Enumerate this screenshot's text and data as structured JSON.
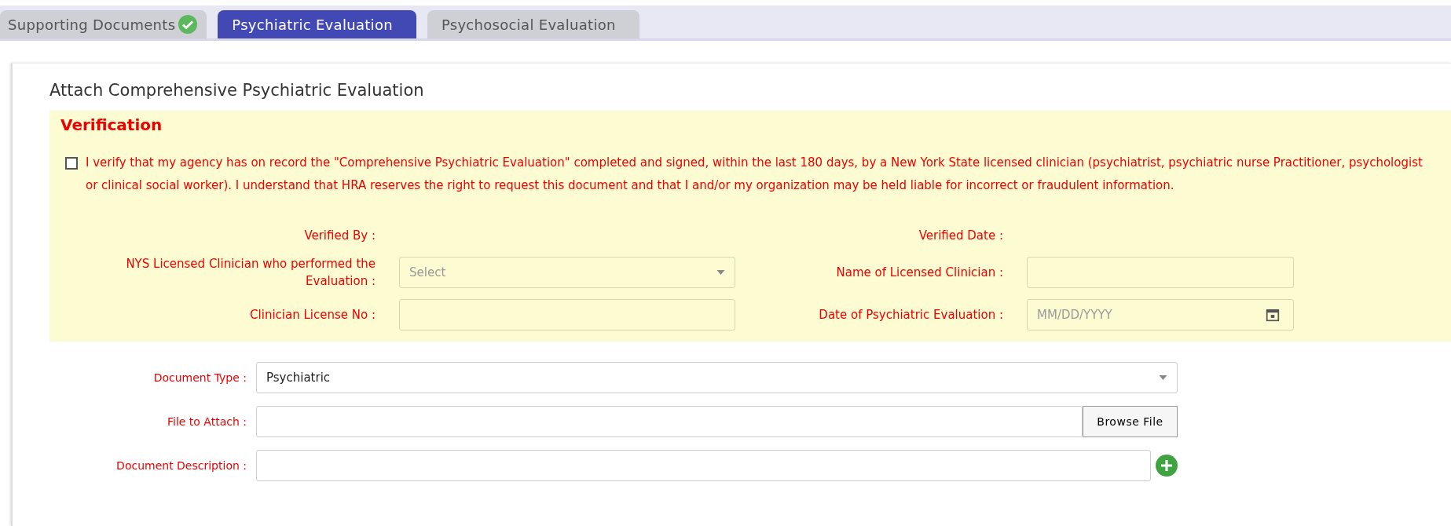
{
  "tabs": [
    {
      "label": "Supporting Documents",
      "selected": false,
      "completed": true
    },
    {
      "label": "Psychiatric Evaluation",
      "selected": true,
      "completed": false
    },
    {
      "label": "Psychosocial Evaluation",
      "selected": false,
      "completed": false
    }
  ],
  "section_title": "Attach Comprehensive Psychiatric Evaluation",
  "verification": {
    "heading": "Verification",
    "statement": {
      "checked": false,
      "text": "I verify that my agency has on record the \"Comprehensive Psychiatric Evaluation\" completed and signed, within the last 180 days, by a New York State licensed clinician (psychiatrist, psychiatric nurse Practitioner, psychologist or clinical social worker). I understand that HRA reserves the right to request this document and that I and/or my organization may be held liable for incorrect or fraudulent information."
    },
    "fields": [
      {
        "label": "Verified By :",
        "kind": "readonly"
      },
      {
        "label": "Verified Date :",
        "kind": "readonly"
      },
      {
        "label": "NYS Licensed Clinician who performed the Evaluation :",
        "kind": "select",
        "placeholder": "Select"
      },
      {
        "label": "Name of Licensed Clinician :",
        "kind": "text"
      },
      {
        "label": "Clinician License No :",
        "kind": "text"
      },
      {
        "label": "Date of Psychiatric Evaluation :",
        "kind": "date",
        "placeholder": "MM/DD/YYYY"
      }
    ]
  },
  "attachment": [
    {
      "label": "Document Type :",
      "kind": "select",
      "value": "Psychiatric"
    },
    {
      "label": "File to Attach :",
      "kind": "file",
      "button": "Browse File"
    },
    {
      "label": "Document Description :",
      "kind": "add"
    }
  ]
}
